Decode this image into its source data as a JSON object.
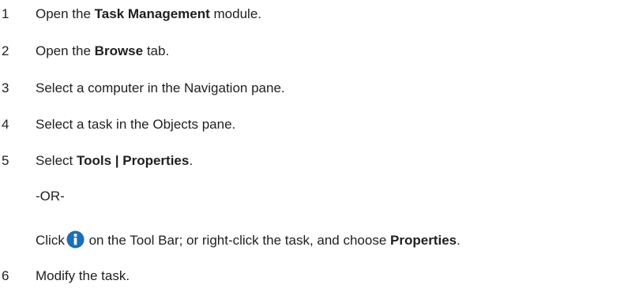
{
  "steps": [
    {
      "number": "1",
      "pre": "Open the ",
      "bold": "Task Management",
      "post": " module."
    },
    {
      "number": "2",
      "pre": "Open the ",
      "bold": "Browse",
      "post": " tab."
    },
    {
      "number": "3",
      "text": "Select a computer in the Navigation pane."
    },
    {
      "number": "4",
      "text": "Select a task in the Objects pane."
    },
    {
      "number": "5",
      "pre": "Select ",
      "bold": "Tools | Properties",
      "post": "."
    },
    {
      "number": "6",
      "text": "Modify the task."
    }
  ],
  "or_text": "-OR-",
  "alt": {
    "click": "Click",
    "icon": "info-icon",
    "middle": " on the Tool Bar; or right-click the task, and choose ",
    "bold": "Properties",
    "end": "."
  },
  "colors": {
    "text": "#1f1f1f",
    "icon_fill": "#1b6fb4"
  }
}
